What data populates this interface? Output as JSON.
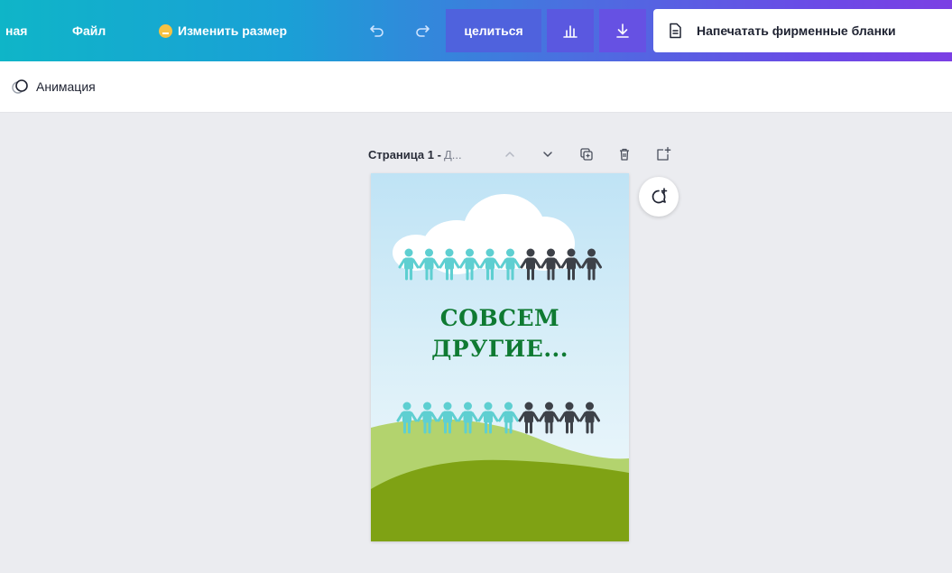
{
  "topbar": {
    "home_partial": "ная",
    "file": "Файл",
    "resize": "Изменить размер",
    "share": "целиться",
    "print": "Напечатать фирменные бланки"
  },
  "toolbar2": {
    "animation": "Анимация"
  },
  "page": {
    "title": "Страница 1 -",
    "subtitle": "Д..."
  },
  "design": {
    "headline_line1": "СОВСЕМ",
    "headline_line2": "ДРУГИЕ..."
  },
  "colors": {
    "headline": "#0f7a32",
    "people_cyan": "#5ecfd1",
    "people_dark": "#3d4148",
    "hill_light": "#b3d36e",
    "hill_dark": "#7fa214"
  },
  "icons": [
    "crown-icon",
    "undo-icon",
    "redo-icon",
    "stats-icon",
    "download-icon",
    "document-icon",
    "animation-icon",
    "chevron-up-icon",
    "chevron-down-icon",
    "duplicate-icon",
    "trash-icon",
    "add-page-icon",
    "comment-add-icon"
  ]
}
